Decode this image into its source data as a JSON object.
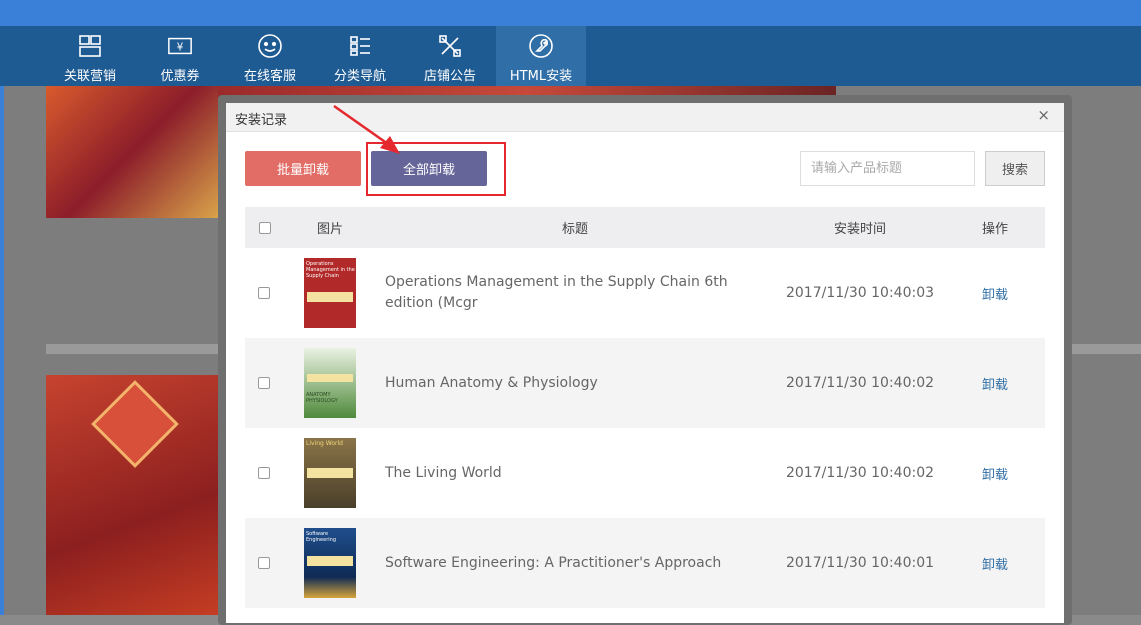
{
  "colors": {
    "nav_bg": "#1f5b93",
    "topbar": "#3a7fd8",
    "batch_btn": "#e26d67",
    "all_btn": "#66659a",
    "highlight": "#e4282d",
    "link": "#2f6ea6"
  },
  "nav": {
    "items": [
      {
        "label": "关联营销",
        "icon": "grid-icon"
      },
      {
        "label": "优惠券",
        "icon": "coupon-icon"
      },
      {
        "label": "在线客服",
        "icon": "smiley-icon"
      },
      {
        "label": "分类导航",
        "icon": "category-list-icon"
      },
      {
        "label": "店铺公告",
        "icon": "pencil-ruler-icon"
      },
      {
        "label": "HTML安装",
        "icon": "wrench-icon"
      }
    ],
    "active_index": 5
  },
  "dialog": {
    "title": "安装记录",
    "close": "×",
    "batch_uninstall": "批量卸载",
    "uninstall_all": "全部卸载",
    "search_placeholder": "请输入产品标题",
    "search_button": "搜索",
    "table": {
      "headers": {
        "image": "图片",
        "title": "标题",
        "time": "安装时间",
        "action": "操作"
      },
      "rows": [
        {
          "title": "Operations Management in the Supply Chain 6th edition (Mcgr",
          "time": "2017/11/30 10:40:03",
          "action": "卸载",
          "cover_color": "#b22929",
          "cover_text": "Operations Management in the Supply Chain"
        },
        {
          "title": "Human Anatomy & Physiology",
          "time": "2017/11/30 10:40:02",
          "action": "卸载",
          "cover_color": "#4f8a3b",
          "cover_text": "ANATOMY PHYSIOLOGY"
        },
        {
          "title": "The Living World",
          "time": "2017/11/30 10:40:02",
          "action": "卸载",
          "cover_color": "#6b5a3a",
          "cover_text": "Living World"
        },
        {
          "title": "Software Engineering: A Practitioner's Approach",
          "time": "2017/11/30 10:40:01",
          "action": "卸载",
          "cover_color": "#1f4e8c",
          "cover_text": "Software Engineering"
        }
      ]
    }
  }
}
